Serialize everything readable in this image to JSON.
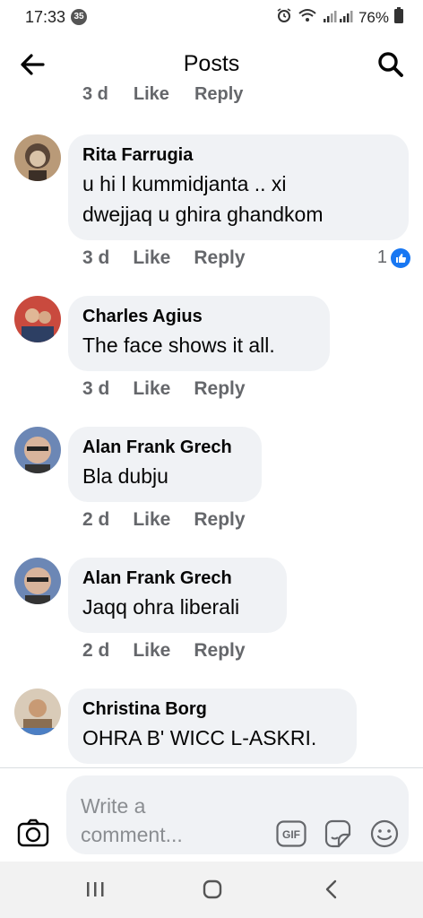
{
  "status_bar": {
    "time": "17:33",
    "notification_count": "35",
    "battery": "76%"
  },
  "header": {
    "title": "Posts"
  },
  "partial_actions": {
    "time": "3 d",
    "like": "Like",
    "reply": "Reply"
  },
  "comments": [
    {
      "author": "Rita Farrugia",
      "text_lines": [
        "u hi l kummidjanta .. xi",
        "dwejjaq u ghira ghandkom"
      ],
      "time": "3 d",
      "like": "Like",
      "reply": "Reply",
      "reaction_count": "1"
    },
    {
      "author": "Charles Agius",
      "text_lines": [
        "The face shows it all."
      ],
      "time": "3 d",
      "like": "Like",
      "reply": "Reply"
    },
    {
      "author": "Alan Frank Grech",
      "text_lines": [
        "Bla dubju"
      ],
      "time": "2 d",
      "like": "Like",
      "reply": "Reply"
    },
    {
      "author": "Alan Frank Grech",
      "text_lines": [
        "Jaqq ohra liberali"
      ],
      "time": "2 d",
      "like": "Like",
      "reply": "Reply"
    },
    {
      "author": "Christina Borg",
      "text_lines": [
        "OHRA B' WICC L-ASKRI."
      ]
    }
  ],
  "composer": {
    "placeholder_line1": "Write a",
    "placeholder_line2": "comment...",
    "gif_label": "GIF"
  },
  "colors": {
    "bubble_bg": "#f0f2f5",
    "meta_text": "#65676b",
    "like_blue": "#1877f2",
    "nav_bg": "#f2f2f2"
  },
  "icons": {
    "back": "arrow-left-icon",
    "search": "search-icon",
    "camera": "camera-icon",
    "gif": "gif-icon",
    "sticker": "sticker-icon",
    "emoji": "emoji-icon",
    "recents": "recents-icon",
    "home": "home-icon",
    "nav_back": "chevron-left-icon"
  }
}
